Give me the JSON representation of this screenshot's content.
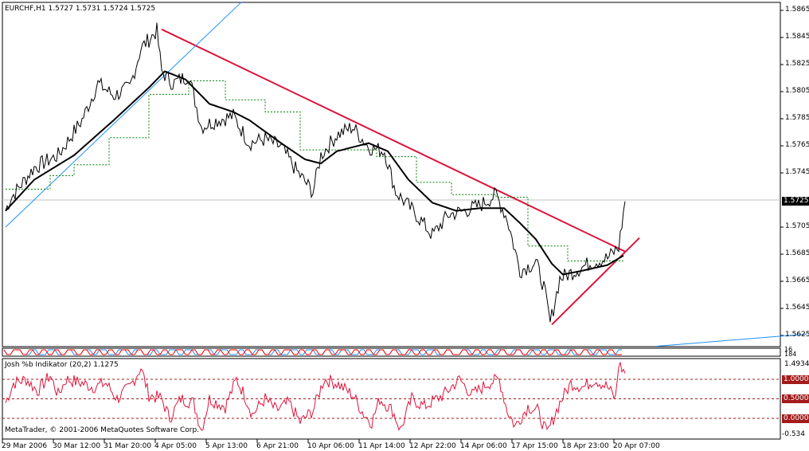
{
  "header": {
    "symbol_info": "EURCHF,H1  1.5727 1.5731 1.5724 1.5725"
  },
  "price_axis": [
    "1.5865",
    "1.5845",
    "1.5825",
    "1.5805",
    "1.5785",
    "1.5765",
    "1.5745",
    "1.5705",
    "1.5685",
    "1.5665",
    "1.5645",
    "1.5625"
  ],
  "current_price": "1.5725",
  "middle_axis": [
    "16",
    "184"
  ],
  "indicator": {
    "title": "Josh %b Indikator (20,2) 1.1275",
    "axis": [
      "1.4934",
      "-0.534"
    ],
    "levels": [
      "1.0000",
      "0.5000",
      "0.0000"
    ]
  },
  "copyright": "MetaTrader, © 2001-2006 MetaQuotes Software Corp.",
  "time_axis": [
    "29 Mar 2006",
    "30 Mar 12:00",
    "31 Mar 20:00",
    "4 Apr 05:00",
    "5 Apr 13:00",
    "6 Apr 21:00",
    "10 Apr 06:00",
    "11 Apr 14:00",
    "12 Apr 22:00",
    "14 Apr 06:00",
    "17 Apr 15:00",
    "18 Apr 23:00",
    "20 Apr 07:00"
  ],
  "colors": {
    "price": "#000000",
    "ma": "#000000",
    "step": "#008000",
    "trend": "#dc143c",
    "channel": "#1e90ff",
    "indicator": "#dc143c",
    "level": "#a31b1b"
  },
  "chart_data": {
    "type": "line",
    "ylim": [
      1.5617,
      1.5874
    ],
    "close": [
      [
        2,
        1.5717
      ],
      [
        5,
        1.5726
      ],
      [
        20,
        1.5749
      ],
      [
        35,
        1.5758
      ],
      [
        50,
        1.5784
      ],
      [
        60,
        1.5811
      ],
      [
        70,
        1.5802
      ],
      [
        80,
        1.5808
      ],
      [
        87,
        1.5837
      ],
      [
        97,
        1.585
      ],
      [
        100,
        1.582
      ],
      [
        107,
        1.5811
      ],
      [
        117,
        1.5817
      ],
      [
        125,
        1.5779
      ],
      [
        135,
        1.5784
      ],
      [
        145,
        1.5787
      ],
      [
        155,
        1.5767
      ],
      [
        165,
        1.577
      ],
      [
        175,
        1.5764
      ],
      [
        185,
        1.5746
      ],
      [
        195,
        1.5731
      ],
      [
        200,
        1.5758
      ],
      [
        210,
        1.5773
      ],
      [
        220,
        1.5779
      ],
      [
        230,
        1.5764
      ],
      [
        240,
        1.5761
      ],
      [
        247,
        1.5731
      ],
      [
        260,
        1.5714
      ],
      [
        270,
        1.5699
      ],
      [
        280,
        1.5714
      ],
      [
        290,
        1.5717
      ],
      [
        300,
        1.5721
      ],
      [
        310,
        1.5729
      ],
      [
        317,
        1.5711
      ],
      [
        325,
        1.5673
      ],
      [
        335,
        1.5679
      ],
      [
        340,
        1.5661
      ],
      [
        344,
        1.5634
      ],
      [
        350,
        1.5667
      ],
      [
        360,
        1.5673
      ],
      [
        370,
        1.5679
      ],
      [
        380,
        1.5682
      ],
      [
        387,
        1.569
      ],
      [
        391,
        1.5724
      ]
    ],
    "ma": [
      [
        2,
        1.5717
      ],
      [
        20,
        1.574
      ],
      [
        45,
        1.5758
      ],
      [
        70,
        1.5784
      ],
      [
        92,
        1.5808
      ],
      [
        102,
        1.582
      ],
      [
        115,
        1.5814
      ],
      [
        130,
        1.5796
      ],
      [
        145,
        1.579
      ],
      [
        155,
        1.5784
      ],
      [
        175,
        1.5767
      ],
      [
        190,
        1.5755
      ],
      [
        200,
        1.5752
      ],
      [
        210,
        1.5761
      ],
      [
        230,
        1.5767
      ],
      [
        242,
        1.5761
      ],
      [
        255,
        1.574
      ],
      [
        270,
        1.5723
      ],
      [
        285,
        1.5717
      ],
      [
        300,
        1.5719
      ],
      [
        315,
        1.5719
      ],
      [
        325,
        1.5708
      ],
      [
        335,
        1.5696
      ],
      [
        345,
        1.5678
      ],
      [
        352,
        1.567
      ],
      [
        365,
        1.5673
      ],
      [
        380,
        1.5677
      ],
      [
        390,
        1.5684
      ]
    ],
    "steps": [
      [
        2,
        1.5733
      ],
      [
        30,
        1.5743
      ],
      [
        45,
        1.5751
      ],
      [
        67,
        1.5771
      ],
      [
        92,
        1.5803
      ],
      [
        117,
        1.5813
      ],
      [
        140,
        1.5799
      ],
      [
        165,
        1.579
      ],
      [
        187,
        1.5762
      ],
      [
        235,
        1.5757
      ],
      [
        260,
        1.5738
      ],
      [
        282,
        1.5729
      ],
      [
        310,
        1.5727
      ],
      [
        330,
        1.5691
      ],
      [
        355,
        1.568
      ],
      [
        390,
        1.568
      ]
    ],
    "trendlines": [
      {
        "name": "down-trend",
        "color": "#dc143c",
        "p1": [
          100,
          1.5851
        ],
        "p2": [
          391,
          1.5687
        ]
      },
      {
        "name": "up-trend",
        "color": "#dc143c",
        "p1": [
          345,
          1.5633
        ],
        "p2": [
          400,
          1.5697
        ]
      },
      {
        "name": "channel-upper",
        "color": "#1e90ff",
        "p1": [
          2,
          1.5705
        ],
        "p2": [
          150,
          1.5871
        ]
      },
      {
        "name": "channel-lower",
        "color": "#1e90ff",
        "p1": [
          410,
          1.5617
        ],
        "p2": [
          505,
          1.5626
        ]
      }
    ],
    "percent_b": [
      [
        2,
        0.4
      ],
      [
        7,
        0.9
      ],
      [
        15,
        1.0
      ],
      [
        22,
        0.7
      ],
      [
        30,
        1.1
      ],
      [
        35,
        0.6
      ],
      [
        40,
        1.0
      ],
      [
        50,
        0.9
      ],
      [
        57,
        0.8
      ],
      [
        65,
        0.9
      ],
      [
        72,
        0.5
      ],
      [
        80,
        0.8
      ],
      [
        87,
        1.3
      ],
      [
        92,
        0.6
      ],
      [
        100,
        0.5
      ],
      [
        105,
        0.0
      ],
      [
        112,
        0.5
      ],
      [
        120,
        0.4
      ],
      [
        125,
        -0.3
      ],
      [
        130,
        0.5
      ],
      [
        140,
        0.3
      ],
      [
        147,
        1.0
      ],
      [
        152,
        0.6
      ],
      [
        157,
        0.1
      ],
      [
        165,
        0.5
      ],
      [
        172,
        0.2
      ],
      [
        180,
        0.4
      ],
      [
        187,
        -0.1
      ],
      [
        195,
        0.2
      ],
      [
        202,
        1.0
      ],
      [
        210,
        0.9
      ],
      [
        220,
        0.6
      ],
      [
        227,
        0.1
      ],
      [
        232,
        -0.1
      ],
      [
        237,
        0.5
      ],
      [
        245,
        0.2
      ],
      [
        250,
        -0.3
      ],
      [
        257,
        0.5
      ],
      [
        265,
        0.3
      ],
      [
        277,
        0.6
      ],
      [
        287,
        1.0
      ],
      [
        295,
        0.6
      ],
      [
        305,
        0.9
      ],
      [
        312,
        1.0
      ],
      [
        317,
        0.2
      ],
      [
        322,
        -0.2
      ],
      [
        330,
        0.3
      ],
      [
        336,
        0.2
      ],
      [
        342,
        -0.4
      ],
      [
        350,
        0.4
      ],
      [
        357,
        0.9
      ],
      [
        365,
        0.8
      ],
      [
        372,
        1.0
      ],
      [
        380,
        0.8
      ],
      [
        385,
        0.5
      ],
      [
        387,
        1.4
      ],
      [
        391,
        1.15
      ]
    ],
    "percent_b_ylim": [
      -0.534,
      1.4934
    ]
  }
}
